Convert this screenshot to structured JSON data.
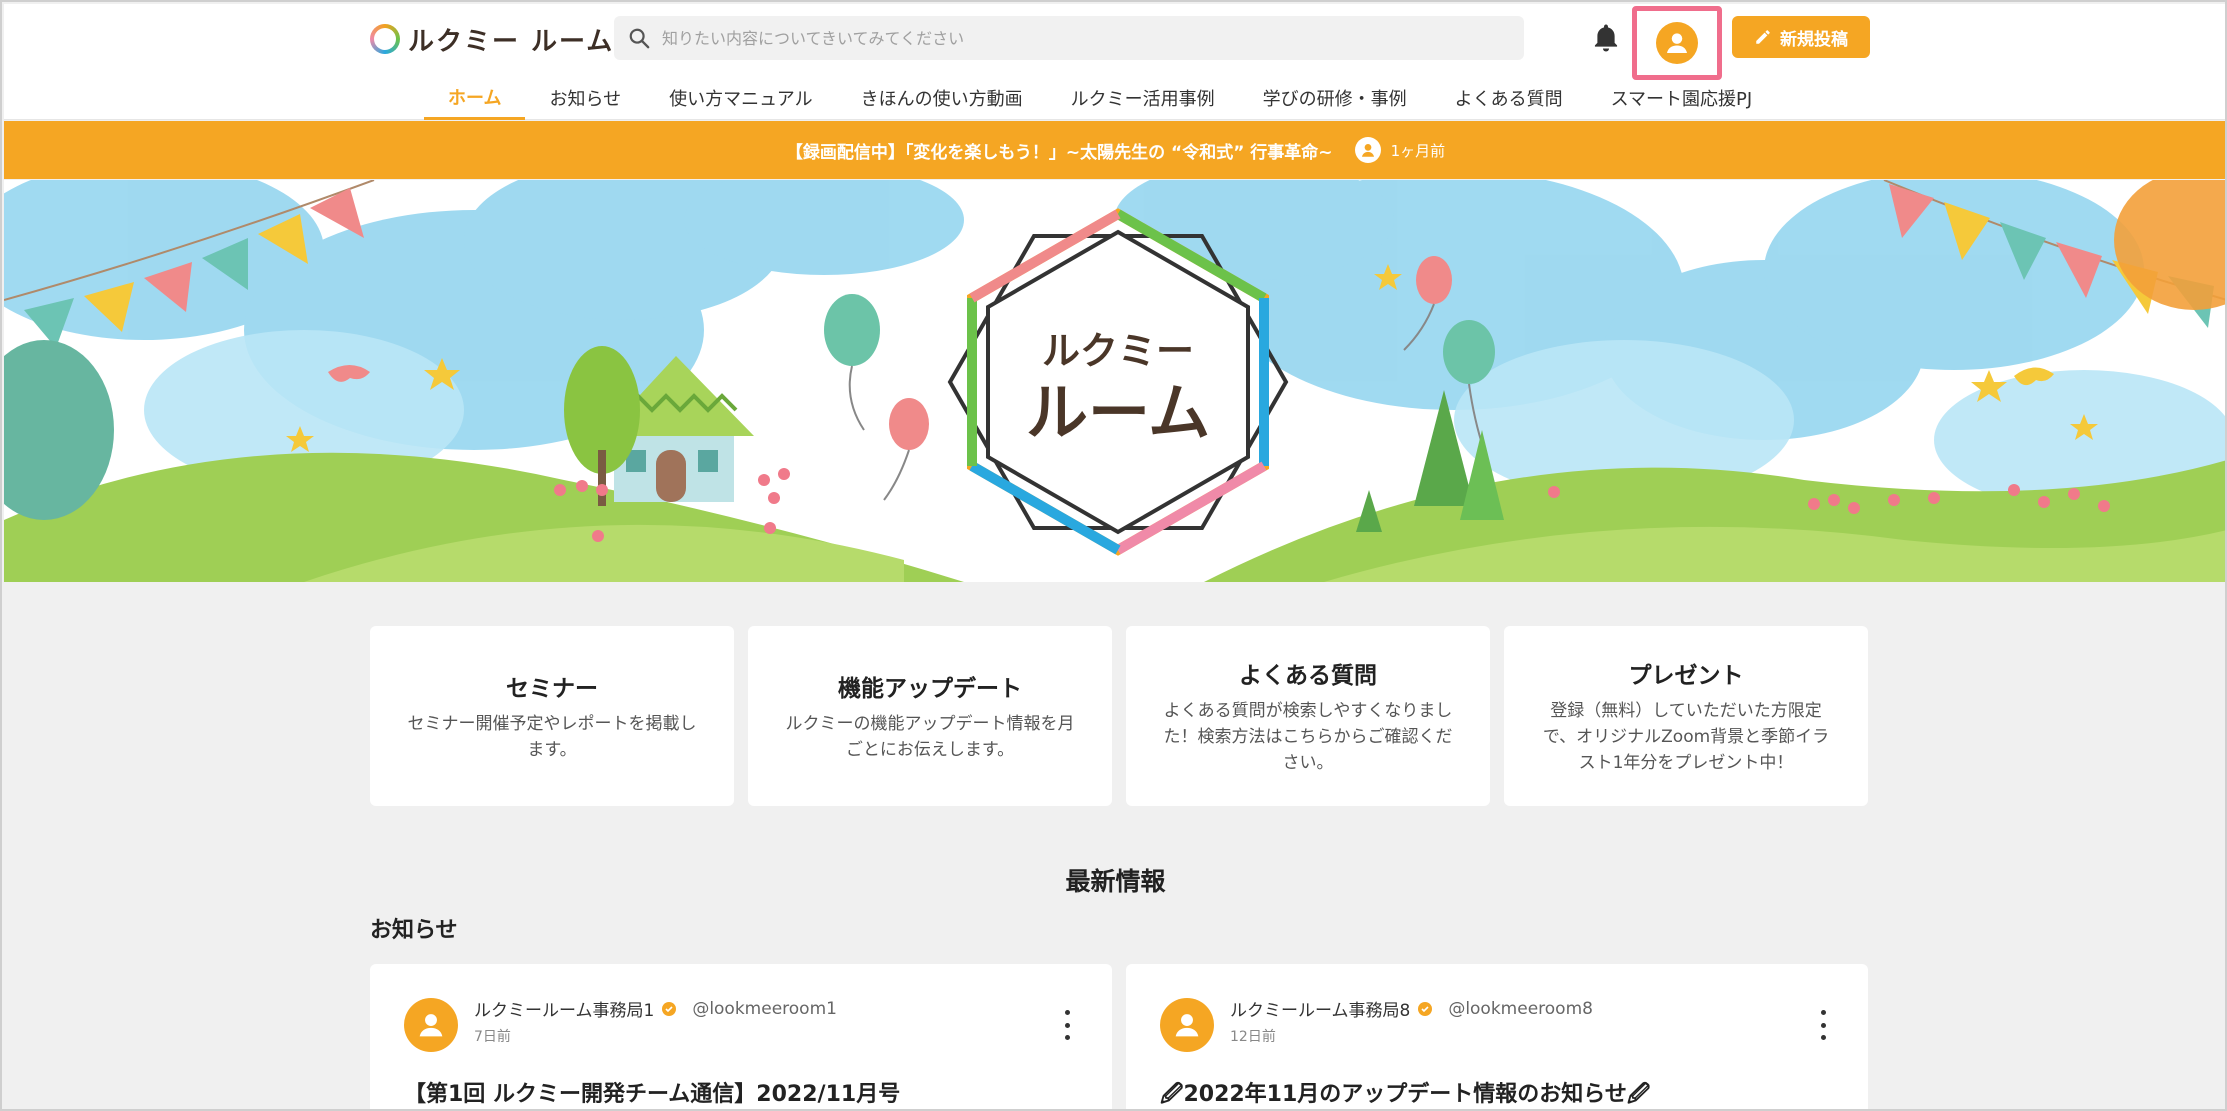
{
  "header": {
    "logo_text": "ルクミー ルーム",
    "search_placeholder": "知りたい内容についてきいてみてください",
    "new_post_label": "新規投稿"
  },
  "nav": {
    "items": [
      {
        "label": "ホーム",
        "active": true
      },
      {
        "label": "お知らせ"
      },
      {
        "label": "使い方マニュアル"
      },
      {
        "label": "きほんの使い方動画"
      },
      {
        "label": "ルクミー活用事例"
      },
      {
        "label": "学びの研修・事例"
      },
      {
        "label": "よくある質問"
      },
      {
        "label": "スマート園応援PJ"
      }
    ]
  },
  "notice": {
    "text": "【録画配信中】「変化を楽しもう！」~太陽先生の “令和式” 行事革命~",
    "time": "1ヶ月前"
  },
  "hero": {
    "logo_line1": "ルクミー",
    "logo_line2": "ルーム"
  },
  "cards": [
    {
      "title": "セミナー",
      "desc": "セミナー開催予定やレポートを掲載します。"
    },
    {
      "title": "機能アップデート",
      "desc": "ルクミーの機能アップデート情報を月ごとにお伝えします。"
    },
    {
      "title": "よくある質問",
      "desc": "よくある質問が検索しやすくなりました！検索方法はこちらからご確認ください。"
    },
    {
      "title": "プレゼント",
      "desc": "登録（無料）していただいた方限定で、オリジナルZoom背景と季節イラスト1年分をプレゼント中！"
    }
  ],
  "latest": {
    "title": "最新情報",
    "section": "お知らせ"
  },
  "posts": [
    {
      "author": "ルクミールーム事務局1",
      "handle": "@lookmeeroom1",
      "time": "7日前",
      "title": "【第1回 ルクミー開発チーム通信】2022/11月号"
    },
    {
      "author": "ルクミールーム事務局8",
      "handle": "@lookmeeroom8",
      "time": "12日前",
      "title": "🖉2022年11月のアップデート情報のお知らせ🖉"
    }
  ],
  "colors": {
    "accent": "#f5a623",
    "highlight_border": "#f06d8c"
  }
}
